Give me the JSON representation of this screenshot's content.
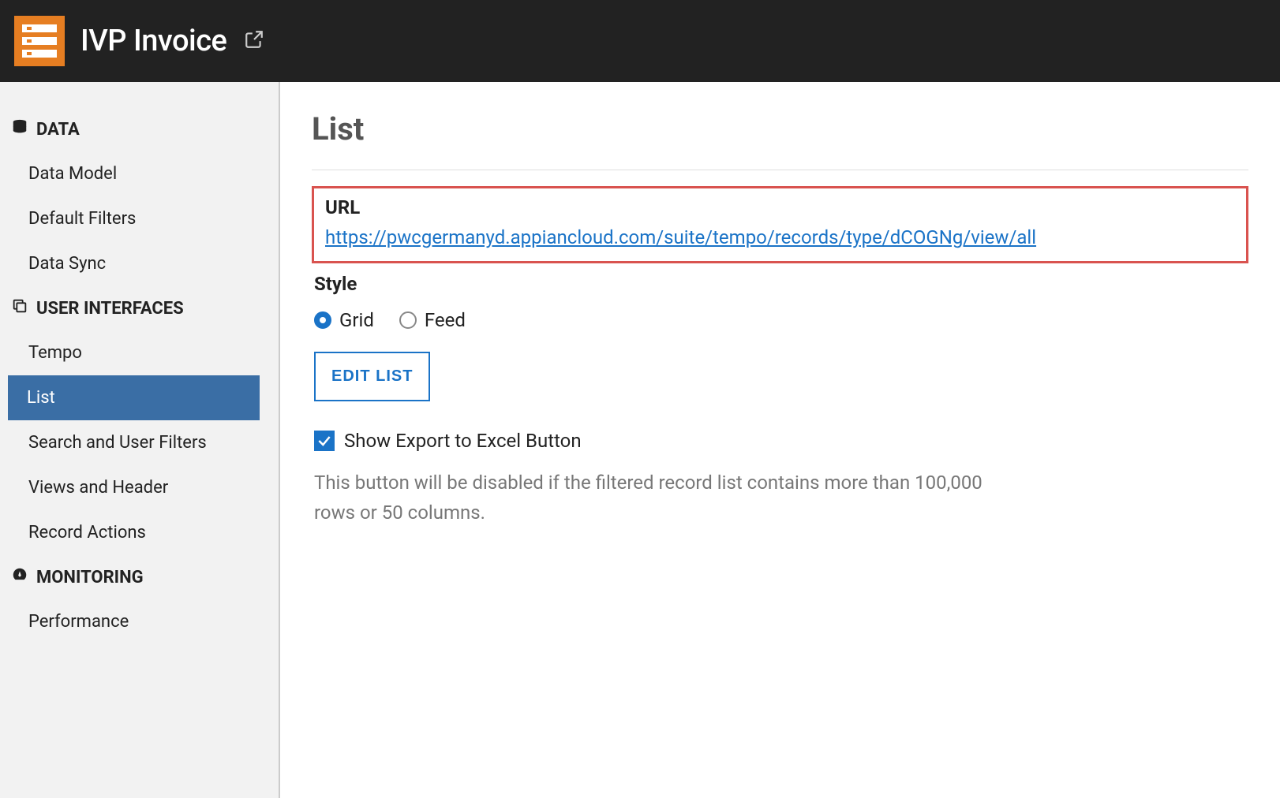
{
  "header": {
    "app_title": "IVP Invoice"
  },
  "sidebar": {
    "sections": [
      {
        "title": "DATA",
        "icon": "database-icon",
        "items": [
          {
            "label": "Data Model",
            "active": false
          },
          {
            "label": "Default Filters",
            "active": false
          },
          {
            "label": "Data Sync",
            "active": false
          }
        ]
      },
      {
        "title": "USER INTERFACES",
        "icon": "copy-icon",
        "items": [
          {
            "label": "Tempo",
            "active": false
          },
          {
            "label": "List",
            "active": true
          },
          {
            "label": "Search and User Filters",
            "active": false
          },
          {
            "label": "Views and Header",
            "active": false
          },
          {
            "label": "Record Actions",
            "active": false
          }
        ]
      },
      {
        "title": "MONITORING",
        "icon": "gauge-icon",
        "items": [
          {
            "label": "Performance",
            "active": false
          }
        ]
      }
    ]
  },
  "main": {
    "page_title": "List",
    "url": {
      "label": "URL",
      "value": "https://pwcgermanyd.appiancloud.com/suite/tempo/records/type/dCOGNg/view/all"
    },
    "style": {
      "label": "Style",
      "options": [
        {
          "label": "Grid",
          "selected": true
        },
        {
          "label": "Feed",
          "selected": false
        }
      ]
    },
    "edit_list_label": "EDIT LIST",
    "export_checkbox": {
      "label": "Show Export to Excel Button",
      "checked": true
    },
    "help_text": "This button will be disabled if the filtered record list contains more than 100,000 rows or 50 columns."
  }
}
